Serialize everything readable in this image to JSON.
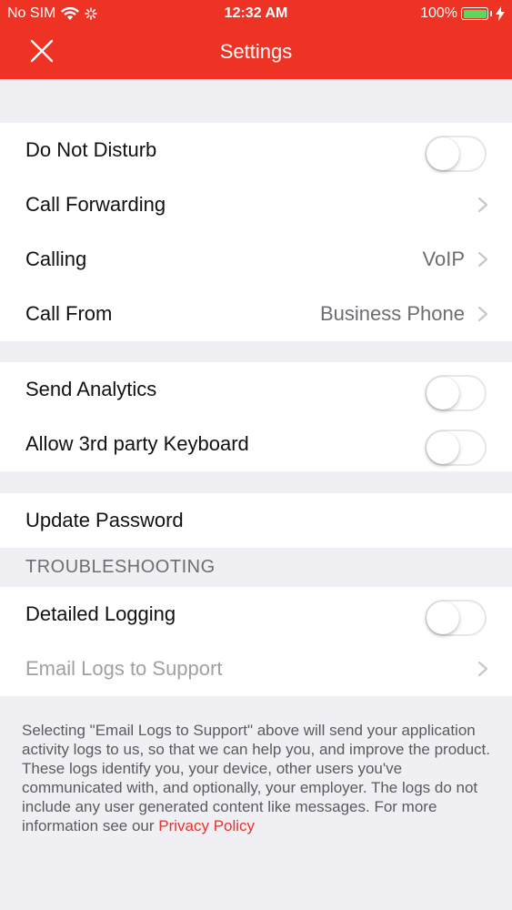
{
  "status_bar": {
    "carrier": "No SIM",
    "time": "12:32 AM",
    "battery": "100%",
    "battery_level": 1.0
  },
  "header": {
    "title": "Settings",
    "close_icon": "close-icon"
  },
  "sections": {
    "general": {
      "do_not_disturb": {
        "label": "Do Not Disturb",
        "enabled": false
      },
      "call_forwarding": {
        "label": "Call Forwarding"
      },
      "calling": {
        "label": "Calling",
        "value": "VoIP"
      },
      "call_from": {
        "label": "Call From",
        "value": "Business Phone"
      }
    },
    "privacy": {
      "send_analytics": {
        "label": "Send Analytics",
        "enabled": false
      },
      "third_party_keyboard": {
        "label": "Allow 3rd party Keyboard",
        "enabled": false
      }
    },
    "account": {
      "update_password": {
        "label": "Update Password"
      }
    },
    "troubleshooting": {
      "header": "TROUBLESHOOTING",
      "detailed_logging": {
        "label": "Detailed Logging",
        "enabled": false
      },
      "email_logs": {
        "label": "Email Logs to Support",
        "disabled": true
      }
    }
  },
  "footer": {
    "note": "Selecting \"Email Logs to Support\" above will send your application activity logs to us, so that we can help you, and improve the product. These logs identify you, your device, other users you've communicated with, and optionally, your employer. The logs do not include any user generated content like messages. For more information see our ",
    "link": "Privacy Policy"
  },
  "colors": {
    "brand": "#ee3224",
    "background": "#efeff4",
    "link": "#e8322a",
    "battery": "#5cd65c"
  }
}
